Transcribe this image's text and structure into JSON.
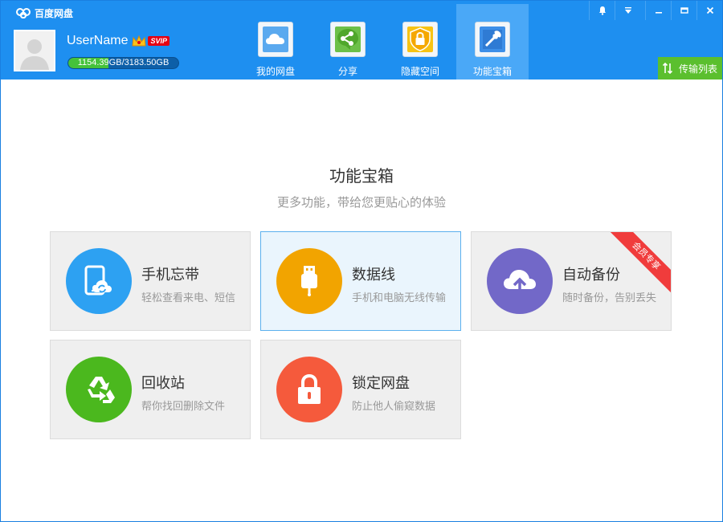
{
  "app": {
    "title": "百度网盘"
  },
  "window_controls": [
    {
      "icon": "bell-icon"
    },
    {
      "icon": "dropdown-icon"
    },
    {
      "icon": "minimize-icon"
    },
    {
      "icon": "maximize-icon"
    },
    {
      "icon": "close-icon"
    }
  ],
  "user": {
    "name": "UserName",
    "badge": "SVIP",
    "quota_used": "1154.39",
    "quota_rest": "GB/3183.50GB",
    "quota_fraction": 0.363
  },
  "nav": {
    "tabs": [
      {
        "label": "我的网盘",
        "icon": "cloud-icon"
      },
      {
        "label": "分享",
        "icon": "share-icon"
      },
      {
        "label": "隐藏空间",
        "icon": "lock-shield-icon"
      },
      {
        "label": "功能宝箱",
        "icon": "toolbox-icon",
        "active": true
      }
    ]
  },
  "transfer": {
    "label": "传输列表"
  },
  "main": {
    "title": "功能宝箱",
    "subtitle": "更多功能，带给您更贴心的体验"
  },
  "cards": [
    {
      "title": "手机忘带",
      "desc": "轻松查看来电、短信",
      "icon": "phone-sync-icon",
      "color": "#2da1f2"
    },
    {
      "title": "数据线",
      "desc": "手机和电脑无线传输",
      "icon": "usb-icon",
      "color": "#f2a400"
    },
    {
      "title": "自动备份",
      "desc": "随时备份，告别丢失",
      "icon": "cloud-upload-icon",
      "color": "#7268c8",
      "ribbon": "会员专享"
    },
    {
      "title": "回收站",
      "desc": "帮你找回删除文件",
      "icon": "recycle-icon",
      "color": "#4bb81e"
    },
    {
      "title": "锁定网盘",
      "desc": "防止他人偷窥数据",
      "icon": "lock-icon",
      "color": "#f55a3c"
    }
  ],
  "colors": {
    "header": "#1e8ff0",
    "active_tab": "#4aa8f7",
    "transfer": "#5bbf2e",
    "quota_fill": "#45c23a"
  }
}
